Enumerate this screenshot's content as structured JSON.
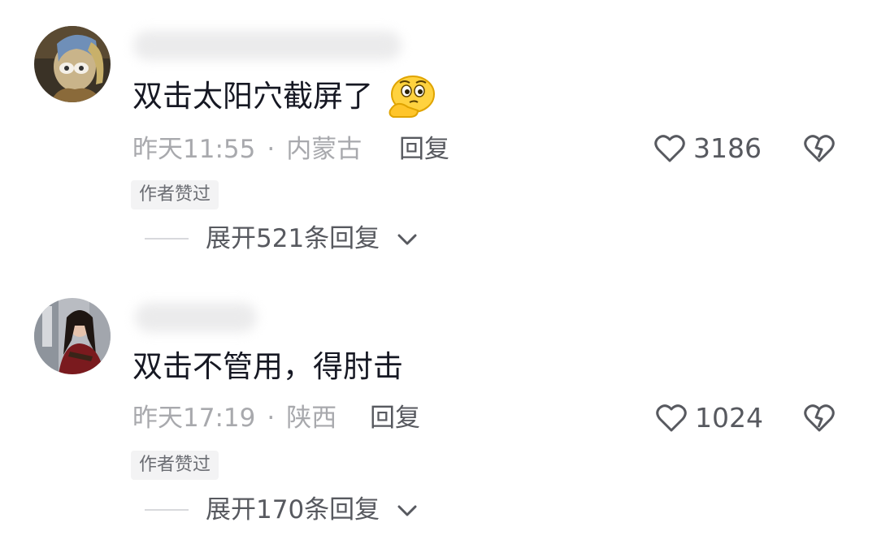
{
  "comments": [
    {
      "text": "双击太阳穴截屏了",
      "emoji": "thinking-face-emoji",
      "time": "昨天11:55",
      "separator": "·",
      "location": "内蒙古",
      "reply_label": "回复",
      "likes": "3186",
      "badge": "作者赞过",
      "expand_label": "展开521条回复"
    },
    {
      "text": "双击不管用，得肘击",
      "time": "昨天17:19",
      "separator": "·",
      "location": "陕西",
      "reply_label": "回复",
      "likes": "1024",
      "badge": "作者赞过",
      "expand_label": "展开170条回复"
    }
  ],
  "icons": {
    "like": "heart-outline-icon",
    "dislike": "broken-heart-icon",
    "expand": "chevron-down-icon"
  },
  "colors": {
    "text": "#161823",
    "meta": "#a8a9ad",
    "secondary": "#57595f",
    "badge_bg": "#f3f3f4"
  }
}
